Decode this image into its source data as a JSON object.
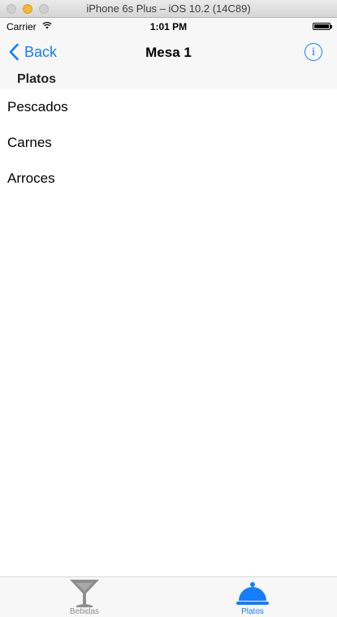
{
  "window": {
    "title": "iPhone 6s Plus – iOS 10.2 (14C89)"
  },
  "status_bar": {
    "carrier": "Carrier",
    "time": "1:01 PM"
  },
  "nav_bar": {
    "back_label": "Back",
    "title": "Mesa 1"
  },
  "section": {
    "title": "Platos"
  },
  "list": {
    "items": [
      {
        "label": "Pescados"
      },
      {
        "label": "Carnes"
      },
      {
        "label": "Arroces"
      }
    ]
  },
  "tab_bar": {
    "tabs": [
      {
        "label": "Bebidas",
        "icon": "cocktail-glass-icon",
        "selected": false
      },
      {
        "label": "Platos",
        "icon": "serving-dish-icon",
        "selected": true
      }
    ]
  },
  "colors": {
    "accent": "#147efb",
    "inactive_tab": "#8e8e8e",
    "bar_background": "#f7f7f7"
  }
}
